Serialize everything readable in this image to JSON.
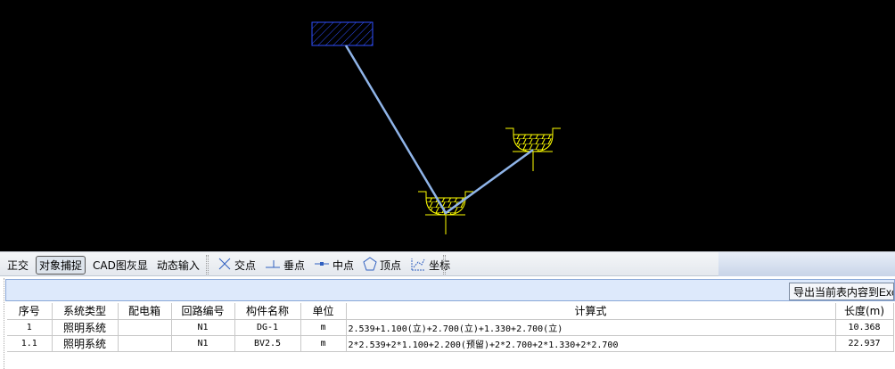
{
  "canvas": {
    "background": "#000000",
    "lamp_color": "#ffff00",
    "wire_color": "#8fb4e8",
    "box_color": "#3050ff"
  },
  "toolbar": {
    "modes": [
      {
        "label": "正交",
        "active": false
      },
      {
        "label": "对象捕捉",
        "active": true
      },
      {
        "label": "CAD图灰显",
        "active": false
      },
      {
        "label": "动态输入",
        "active": false
      }
    ],
    "snaps": [
      {
        "label": "交点",
        "icon": "intersection-icon"
      },
      {
        "label": "垂点",
        "icon": "perpendicular-icon"
      },
      {
        "label": "中点",
        "icon": "midpoint-icon"
      },
      {
        "label": "顶点",
        "icon": "vertex-icon"
      },
      {
        "label": "坐标",
        "icon": "coordinate-icon"
      }
    ]
  },
  "export_button": "导出当前表内容到Excel",
  "table": {
    "columns": [
      "序号",
      "系统类型",
      "配电箱",
      "回路编号",
      "构件名称",
      "单位",
      "计算式",
      "长度(m)"
    ],
    "rows": [
      [
        "1",
        "照明系统",
        "",
        "N1",
        "DG-1",
        "m",
        "2.539+1.100(立)+2.700(立)+1.330+2.700(立)",
        "10.368"
      ],
      [
        "1.1",
        "照明系统",
        "",
        "N1",
        "BV2.5",
        "m",
        "2*2.539+2*1.100+2.200(预留)+2*2.700+2*1.330+2*2.700",
        "22.937"
      ]
    ]
  }
}
